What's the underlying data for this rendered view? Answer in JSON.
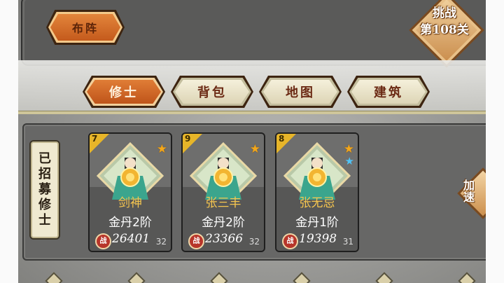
{
  "buttons": {
    "formation": "布阵"
  },
  "challenge": {
    "line1": "挑战",
    "line2": "第108关"
  },
  "tabs": [
    {
      "label": "修士",
      "active": true
    },
    {
      "label": "背包",
      "active": false
    },
    {
      "label": "地图",
      "active": false
    },
    {
      "label": "建筑",
      "active": false
    }
  ],
  "side_tab": {
    "chars": [
      "已",
      "招",
      "募",
      "修",
      "士"
    ]
  },
  "cultivators": [
    {
      "level_badge": "7",
      "name": "剑神",
      "realm": "金丹2阶",
      "power": "26401",
      "level": "32",
      "stars": [
        "gold"
      ]
    },
    {
      "level_badge": "9",
      "name": "张三丰",
      "realm": "金丹2阶",
      "power": "23366",
      "level": "32",
      "stars": [
        "gold"
      ]
    },
    {
      "level_badge": "8",
      "name": "张无忌",
      "realm": "金丹1阶",
      "power": "19398",
      "level": "31",
      "stars": [
        "gold",
        "blue"
      ]
    }
  ],
  "power_icon_text": "战",
  "speed_button": {
    "line1": "加",
    "line2": "速"
  },
  "colors": {
    "accent": "#d9722e",
    "gold_text": "#f6c64f",
    "star_gold": "#f2a71c",
    "star_blue": "#4fc3f7"
  }
}
